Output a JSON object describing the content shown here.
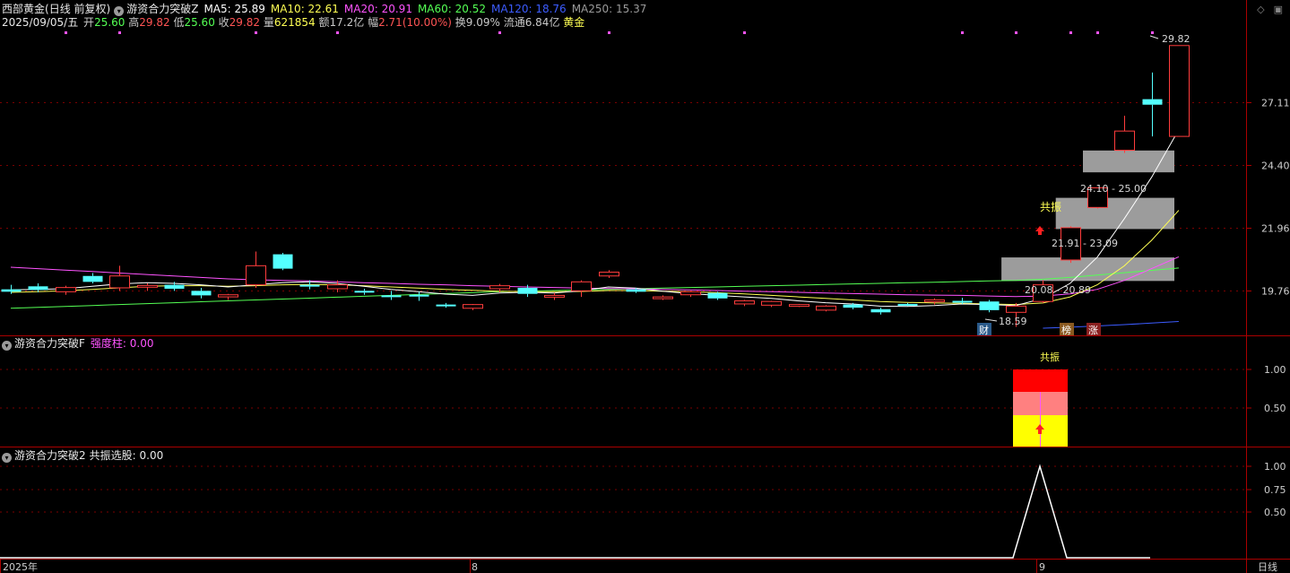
{
  "header": {
    "stock_name": "西部黄金",
    "mode": "(日线 前复权)",
    "indicator_main": "游资合力突破Z",
    "ma": [
      {
        "label": "MA5: 25.89",
        "color": "#ffffff"
      },
      {
        "label": "MA10: 22.61",
        "color": "#ffff54"
      },
      {
        "label": "MA20: 20.91",
        "color": "#ff54ff"
      },
      {
        "label": "MA60: 20.52",
        "color": "#54ff54"
      },
      {
        "label": "MA120: 18.76",
        "color": "#3c5cff"
      },
      {
        "label": "MA250: 15.37",
        "color": "#9a9a9a"
      }
    ],
    "date": "2025/09/05/五",
    "open_label": "开",
    "open_value": "25.60",
    "high_label": "高",
    "high_value": "29.82",
    "low_label": "低",
    "low_value": "25.60",
    "close_label": "收",
    "close_value": "29.82",
    "vol_label": "量",
    "vol_value": "621854",
    "amount": "额17.2亿",
    "change_label": "幅",
    "change_value": "2.71(10.00%)",
    "turnover": "换9.09%",
    "float_cap": "流通6.84亿",
    "sector": "黄金"
  },
  "window_icons": {
    "diamond": "◇",
    "scroll": "▣"
  },
  "main_axis": {
    "ticks": [
      "27.11",
      "24.40",
      "21.96",
      "19.76"
    ],
    "tick_values": [
      27.11,
      24.4,
      21.96,
      19.76
    ]
  },
  "annotations": {
    "high_price": "29.82",
    "low_price": "18.59",
    "zone1": "24.10 - 25.00",
    "zone2": "21.91 - 23.09",
    "zone3": "20.08 - 20.89",
    "resonance": "共振",
    "cai_badge": "财",
    "bang_badge": "榜",
    "zhang_badge": "涨"
  },
  "indicator1": {
    "name": "游资合力突破F",
    "param": "强度柱: 0.00",
    "ticks": [
      "1.00",
      "0.50"
    ],
    "top_label": "共振"
  },
  "indicator2": {
    "name": "游资合力突破2",
    "param": "共振选股: 0.00",
    "ticks": [
      "1.00",
      "0.75",
      "0.50"
    ]
  },
  "x_axis": {
    "labels": [
      "2025年",
      "8",
      "9"
    ],
    "period": "日线"
  },
  "colors": {
    "up": "#ff3c3c",
    "down": "#54ffff",
    "grid": "#7a0000",
    "border": "#aa0000"
  },
  "candles": [
    {
      "o": 19.8,
      "h": 19.95,
      "l": 19.65,
      "c": 19.72
    },
    {
      "o": 19.9,
      "h": 20.0,
      "l": 19.7,
      "c": 19.78
    },
    {
      "o": 19.72,
      "h": 19.92,
      "l": 19.62,
      "c": 19.86
    },
    {
      "o": 20.25,
      "h": 20.35,
      "l": 20.0,
      "c": 20.05
    },
    {
      "o": 19.85,
      "h": 20.6,
      "l": 19.75,
      "c": 20.25
    },
    {
      "o": 19.9,
      "h": 20.0,
      "l": 19.75,
      "c": 19.93
    },
    {
      "o": 19.95,
      "h": 20.05,
      "l": 19.75,
      "c": 19.82
    },
    {
      "o": 19.75,
      "h": 19.85,
      "l": 19.5,
      "c": 19.6
    },
    {
      "o": 19.55,
      "h": 19.65,
      "l": 19.45,
      "c": 19.62
    },
    {
      "o": 19.95,
      "h": 21.1,
      "l": 19.85,
      "c": 20.6
    },
    {
      "o": 21.0,
      "h": 21.05,
      "l": 20.45,
      "c": 20.5
    },
    {
      "o": 19.95,
      "h": 20.1,
      "l": 19.8,
      "c": 19.9
    },
    {
      "o": 19.82,
      "h": 20.1,
      "l": 19.7,
      "c": 19.95
    },
    {
      "o": 19.75,
      "h": 19.82,
      "l": 19.62,
      "c": 19.72
    },
    {
      "o": 19.6,
      "h": 19.75,
      "l": 19.45,
      "c": 19.55
    },
    {
      "o": 19.62,
      "h": 19.72,
      "l": 19.42,
      "c": 19.58
    },
    {
      "o": 19.3,
      "h": 19.35,
      "l": 19.2,
      "c": 19.28
    },
    {
      "o": 19.18,
      "h": 19.32,
      "l": 19.12,
      "c": 19.3
    },
    {
      "o": 19.82,
      "h": 19.98,
      "l": 19.7,
      "c": 19.92
    },
    {
      "o": 19.85,
      "h": 19.95,
      "l": 19.55,
      "c": 19.65
    },
    {
      "o": 19.55,
      "h": 19.68,
      "l": 19.45,
      "c": 19.6
    },
    {
      "o": 19.75,
      "h": 20.1,
      "l": 19.55,
      "c": 20.05
    },
    {
      "o": 20.25,
      "h": 20.45,
      "l": 20.18,
      "c": 20.38
    },
    {
      "o": 19.8,
      "h": 19.85,
      "l": 19.68,
      "c": 19.72
    },
    {
      "o": 19.52,
      "h": 19.6,
      "l": 19.45,
      "c": 19.55
    },
    {
      "o": 19.62,
      "h": 19.75,
      "l": 19.55,
      "c": 19.72
    },
    {
      "o": 19.68,
      "h": 19.72,
      "l": 19.45,
      "c": 19.5
    },
    {
      "o": 19.32,
      "h": 19.45,
      "l": 19.25,
      "c": 19.42
    },
    {
      "o": 19.28,
      "h": 19.42,
      "l": 19.22,
      "c": 19.4
    },
    {
      "o": 19.28,
      "h": 19.32,
      "l": 19.22,
      "c": 19.3
    },
    {
      "o": 19.12,
      "h": 19.28,
      "l": 19.08,
      "c": 19.25
    },
    {
      "o": 19.3,
      "h": 19.35,
      "l": 19.15,
      "c": 19.2
    },
    {
      "o": 19.15,
      "h": 19.2,
      "l": 18.98,
      "c": 19.05
    },
    {
      "o": 19.32,
      "h": 19.35,
      "l": 19.25,
      "c": 19.3
    },
    {
      "o": 19.42,
      "h": 19.5,
      "l": 19.3,
      "c": 19.45
    },
    {
      "o": 19.42,
      "h": 19.52,
      "l": 19.32,
      "c": 19.4
    },
    {
      "o": 19.4,
      "h": 19.45,
      "l": 19.05,
      "c": 19.12
    },
    {
      "o": 19.05,
      "h": 19.35,
      "l": 18.59,
      "c": 19.25
    },
    {
      "o": 19.4,
      "h": 20.1,
      "l": 19.35,
      "c": 19.95
    },
    {
      "o": 20.8,
      "h": 22.01,
      "l": 20.7,
      "c": 21.96
    },
    {
      "o": 22.72,
      "h": 23.48,
      "l": 22.68,
      "c": 23.48
    },
    {
      "o": 25.01,
      "h": 26.5,
      "l": 24.9,
      "c": 25.83
    },
    {
      "o": 27.25,
      "h": 28.5,
      "l": 25.6,
      "c": 27.0
    },
    {
      "o": 25.6,
      "h": 29.82,
      "l": 25.6,
      "c": 29.82
    }
  ],
  "ma_lines": {
    "ma5": [
      19.78,
      19.8,
      19.82,
      19.9,
      19.98,
      20.02,
      20.0,
      19.95,
      19.88,
      19.95,
      20.02,
      20.05,
      20.0,
      19.9,
      19.8,
      19.72,
      19.64,
      19.6,
      19.68,
      19.7,
      19.68,
      19.75,
      19.88,
      19.84,
      19.74,
      19.66,
      19.6,
      19.55,
      19.5,
      19.42,
      19.36,
      19.32,
      19.25,
      19.24,
      19.27,
      19.32,
      19.3,
      19.27,
      19.5,
      20.0,
      20.9,
      22.3,
      23.9,
      25.89
    ],
    "ma10": [
      19.7,
      19.72,
      19.75,
      19.8,
      19.85,
      19.9,
      19.92,
      19.92,
      19.9,
      19.92,
      19.95,
      19.96,
      19.95,
      19.92,
      19.88,
      19.84,
      19.8,
      19.77,
      19.74,
      19.72,
      19.72,
      19.73,
      19.76,
      19.76,
      19.74,
      19.72,
      19.69,
      19.65,
      19.6,
      19.55,
      19.5,
      19.45,
      19.4,
      19.37,
      19.35,
      19.34,
      19.32,
      19.3,
      19.35,
      19.55,
      19.95,
      20.6,
      21.5,
      22.61
    ],
    "ma20": [
      20.55,
      20.5,
      20.45,
      20.4,
      20.35,
      20.3,
      20.25,
      20.2,
      20.15,
      20.12,
      20.1,
      20.08,
      20.05,
      20.02,
      20.0,
      19.97,
      19.95,
      19.92,
      19.9,
      19.88,
      19.86,
      19.84,
      19.83,
      19.82,
      19.8,
      19.78,
      19.76,
      19.74,
      19.72,
      19.7,
      19.68,
      19.66,
      19.64,
      19.62,
      19.61,
      19.6,
      19.58,
      19.56,
      19.58,
      19.65,
      19.8,
      20.1,
      20.5,
      20.91
    ],
    "ma60": [
      19.18,
      19.21,
      19.24,
      19.27,
      19.3,
      19.33,
      19.36,
      19.39,
      19.42,
      19.45,
      19.48,
      19.51,
      19.54,
      19.57,
      19.6,
      19.63,
      19.66,
      19.69,
      19.72,
      19.74,
      19.76,
      19.78,
      19.8,
      19.82,
      19.84,
      19.86,
      19.88,
      19.9,
      19.92,
      19.94,
      19.96,
      19.98,
      20.0,
      20.02,
      20.04,
      20.06,
      20.08,
      20.1,
      20.14,
      20.2,
      20.28,
      20.36,
      20.44,
      20.52
    ],
    "ma120_start_index": 38,
    "ma120": [
      18.55,
      18.58,
      18.62,
      18.66,
      18.71,
      18.76
    ]
  },
  "zones": [
    {
      "lo": 24.1,
      "hi": 25.0,
      "from": 40
    },
    {
      "lo": 21.91,
      "hi": 23.09,
      "from": 39
    },
    {
      "lo": 20.08,
      "hi": 20.89,
      "from": 37
    }
  ]
}
